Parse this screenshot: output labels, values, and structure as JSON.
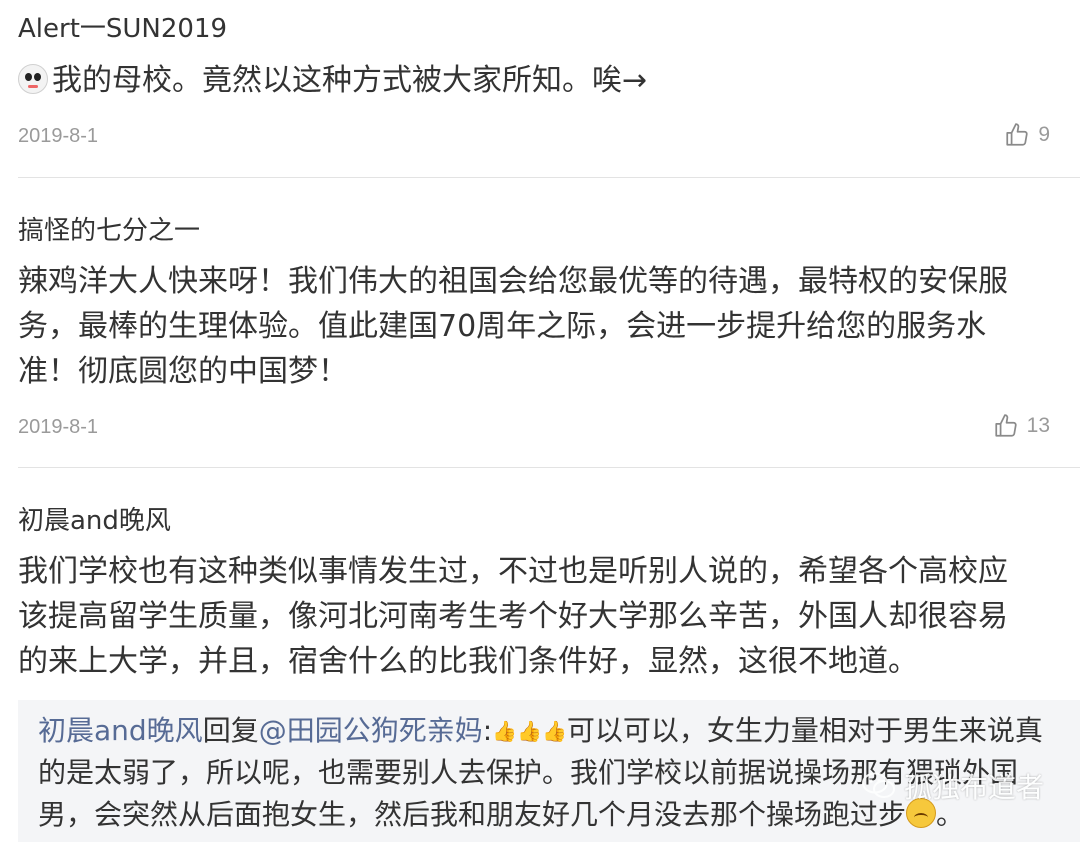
{
  "comments": [
    {
      "username": "Alert一SUN2019",
      "text_lines": [
        "我的母校。竟然以这种方式被大家所知。唉→"
      ],
      "date": "2019-8-1",
      "likes": "9"
    },
    {
      "username": "搞怪的七分之一",
      "text_lines": [
        "辣鸡洋大人快来呀！我们伟大的祖国会给您最优等的待遇，最特权的安保服",
        "务，最棒的生理体验。值此建国70周年之际，会进一步提升给您的服务水",
        "准！彻底圆您的中国梦！"
      ],
      "date": "2019-8-1",
      "likes": "13"
    },
    {
      "username": "初晨and晚风",
      "text_lines": [
        "我们学校也有这种类似事情发生过，不过也是听别人说的，希望各个高校应",
        "该提高留学生质量，像河北河南考生考个好大学那么辛苦，外国人却很容易",
        "的来上大学，并且，宿舍什么的比我们条件好，显然，这很不地道。"
      ],
      "reply": {
        "author": "初晨and晚风",
        "verb": "回复",
        "mention": "@田园公狗死亲妈",
        "colon": ":",
        "line1_rest": "可以可以，女生力量相对于男生来说真",
        "line2": "的是太弱了，所以呢，也需要别人去保护。我们学校以前据说操场那有猥琐外国",
        "line3": "男，会突然从后面抱女生，然后我和朋友好几个月没去那个操场跑过步"
      }
    }
  ],
  "watermark": "孤独布道者",
  "icons": {
    "like": "thumbs-up-icon",
    "avatar_emoji": "panda-face-icon",
    "thumbs_emoji": "thumbs-up-emoji",
    "face_emoji": "upside-down-face-emoji",
    "watermark_logo": "wechat-logo-icon"
  },
  "colors": {
    "link": "#576b95",
    "meta": "#9a9a9a",
    "reply_bg": "#f4f5f7"
  }
}
